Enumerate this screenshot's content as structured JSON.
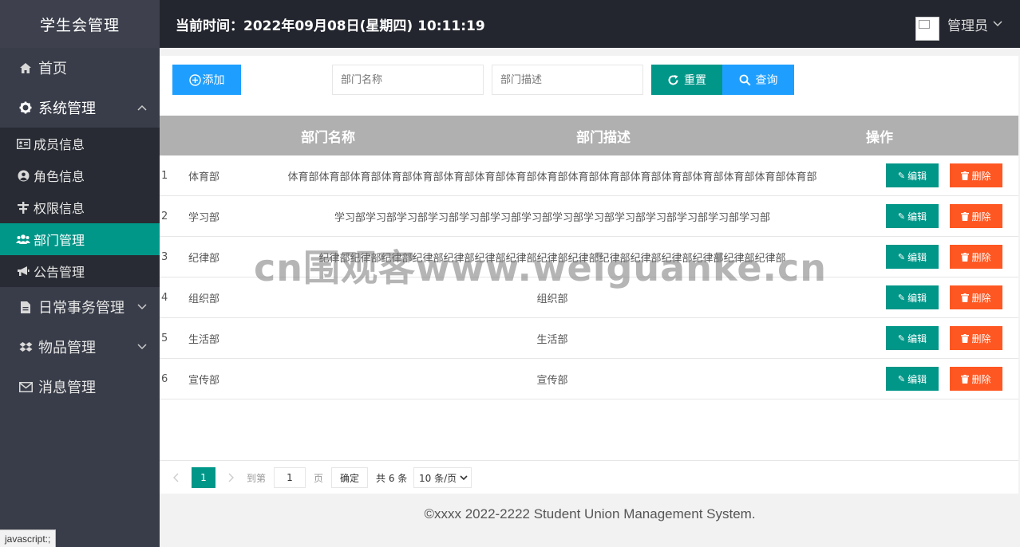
{
  "app": {
    "title": "学生会管理",
    "clock_label": "当前时间：2022年09月08日(星期四) 10:11:19",
    "user_name": "管理员"
  },
  "sidebar": {
    "items": [
      {
        "label": "首页",
        "icon": "home-icon"
      },
      {
        "label": "系统管理",
        "icon": "gear-icon",
        "expanded": true,
        "children": [
          {
            "label": "成员信息",
            "icon": "id-card-icon"
          },
          {
            "label": "角色信息",
            "icon": "user-circle-icon"
          },
          {
            "label": "权限信息",
            "icon": "permission-icon"
          },
          {
            "label": "部门管理",
            "icon": "users-icon",
            "active": true
          },
          {
            "label": "公告管理",
            "icon": "bullhorn-icon"
          }
        ]
      },
      {
        "label": "日常事务管理",
        "icon": "file-icon"
      },
      {
        "label": "物品管理",
        "icon": "dropbox-icon"
      },
      {
        "label": "消息管理",
        "icon": "envelope-icon"
      }
    ]
  },
  "toolbar": {
    "add_label": "添加",
    "dept_name_placeholder": "部门名称",
    "dept_desc_placeholder": "部门描述",
    "reset_label": "重置",
    "query_label": "查询"
  },
  "table": {
    "headers": [
      "部门名称",
      "部门描述",
      "操作"
    ],
    "edit_label": "编辑",
    "delete_label": "删除",
    "rows": [
      {
        "idx": "1",
        "name": "体育部",
        "desc": "体育部体育部体育部体育部体育部体育部体育部体育部体育部体育部体育部体育部体育部体育部体育部体育部体育部"
      },
      {
        "idx": "2",
        "name": "学习部",
        "desc": "学习部学习部学习部学习部学习部学习部学习部学习部学习部学习部学习部学习部学习部学习部"
      },
      {
        "idx": "3",
        "name": "纪律部",
        "desc": "纪律部纪律部纪律部纪律部纪律部纪律部纪律部纪律部纪律部纪律部纪律部纪律部纪律部纪律部纪律部"
      },
      {
        "idx": "4",
        "name": "组织部",
        "desc": "组织部"
      },
      {
        "idx": "5",
        "name": "生活部",
        "desc": "生活部"
      },
      {
        "idx": "6",
        "name": "宣传部",
        "desc": "宣传部"
      }
    ]
  },
  "pager": {
    "current_page": "1",
    "goto_label": "到第",
    "goto_value": "1",
    "page_unit": "页",
    "confirm_label": "确定",
    "total_label": "共 6 条",
    "page_size": "10 条/页"
  },
  "footer": {
    "text": "©xxxx 2022-2222 Student Union Management System."
  },
  "watermark": "cn围观客www.weiguanke.cn",
  "status_url": "javascript:;",
  "colors": {
    "sidebar_bg": "#393d49",
    "header_bg": "#23262e",
    "accent_teal": "#009688",
    "accent_blue": "#1e9fff",
    "danger": "#ff5722"
  }
}
